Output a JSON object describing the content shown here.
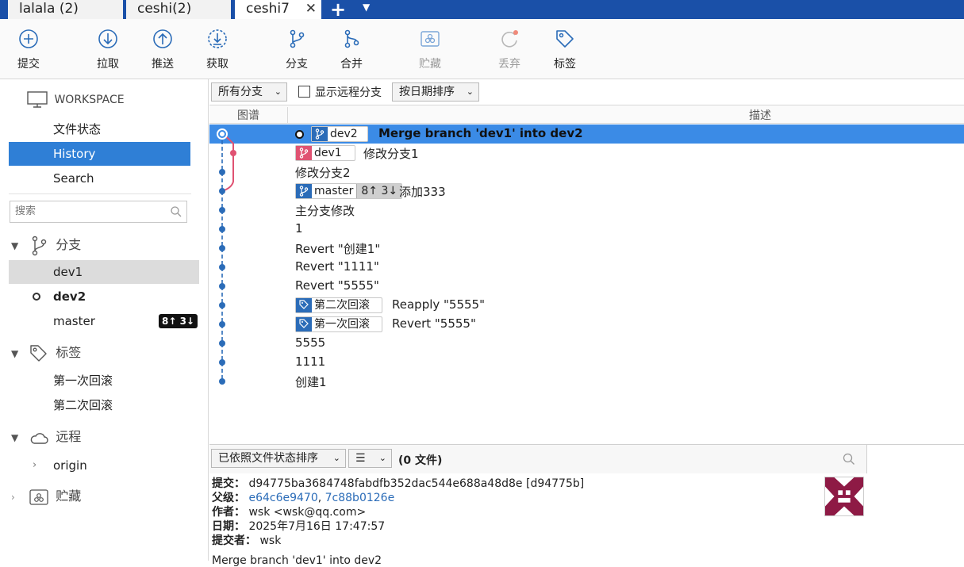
{
  "tabs": [
    {
      "label": "lalala (2)"
    },
    {
      "label": "ceshi(2)"
    },
    {
      "label": "ceshi7"
    }
  ],
  "toolbar": {
    "commit": "提交",
    "pull": "拉取",
    "push": "推送",
    "fetch": "获取",
    "branch": "分支",
    "merge": "合并",
    "stash": "贮藏",
    "discard": "丢弃",
    "tag": "标签"
  },
  "sidebar": {
    "workspace": "WORKSPACE",
    "nav": [
      "文件状态",
      "History",
      "Search"
    ],
    "search_placeholder": "搜索",
    "branches_title": "分支",
    "branches": [
      {
        "name": "dev1"
      },
      {
        "name": "dev2"
      },
      {
        "name": "master",
        "badge": "8↑ 3↓"
      }
    ],
    "tags_title": "标签",
    "tags": [
      "第一次回滚",
      "第二次回滚"
    ],
    "remotes_title": "远程",
    "remotes": [
      "origin"
    ],
    "stashes_title": "贮藏"
  },
  "filter": {
    "branches": "所有分支",
    "show_remote": "显示远程分支",
    "sort": "按日期排序"
  },
  "columns": {
    "graph": "图谱",
    "desc": "描述"
  },
  "commits": [
    {
      "ref": "dev2",
      "desc": "Merge branch 'dev1' into dev2"
    },
    {
      "ref": "dev1",
      "desc": "修改分支1"
    },
    {
      "desc": "修改分支2"
    },
    {
      "ref": "master",
      "ahead_behind": "8↑ 3↓",
      "desc": "添加333"
    },
    {
      "desc": "主分支修改"
    },
    {
      "desc": "1"
    },
    {
      "desc": "Revert \"创建1\""
    },
    {
      "desc": "Revert \"1111\""
    },
    {
      "desc": "Revert \"5555\""
    },
    {
      "tag": "第二次回滚",
      "desc": "Reapply \"5555\""
    },
    {
      "tag": "第一次回滚",
      "desc": "Revert \"5555\""
    },
    {
      "desc": "5555"
    },
    {
      "desc": "1111"
    },
    {
      "desc": "创建1"
    }
  ],
  "bottom": {
    "sort": "已依照文件状态排序",
    "files": "(0 文件)",
    "commit_label": "提交：",
    "commit_hash": "d94775ba3684748fabdfb352dac544e688a48d8e [d94775b]",
    "parents_label": "父级：",
    "parent1": "e64c6e9470",
    "parent_sep": ", ",
    "parent2": "7c88b0126e",
    "author_label": "作者：",
    "author": "wsk <wsk@qq.com>",
    "date_label": "日期：",
    "date": "2025年7月16日 17:47:57",
    "committer_label": "提交者：",
    "committer": "wsk",
    "message": "Merge branch 'dev1' into dev2"
  },
  "colors": {
    "accent": "#2f7fd6",
    "tabbar": "#1a50a8",
    "graph_blue": "#2b6cb8",
    "graph_pink": "#e05272"
  }
}
